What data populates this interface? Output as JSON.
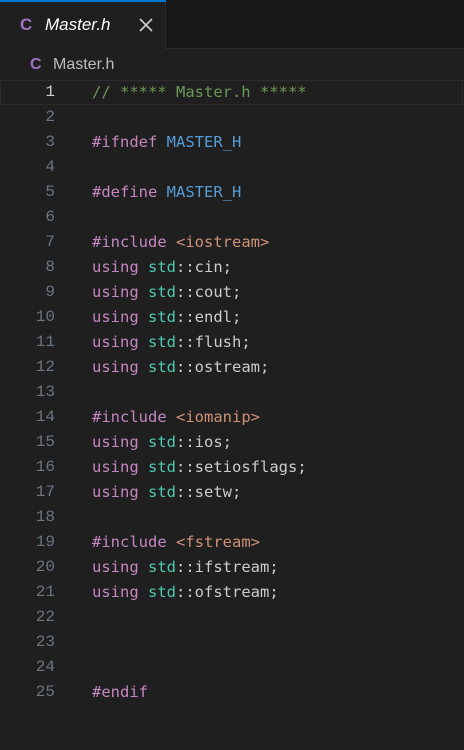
{
  "tab": {
    "lang_icon": "C",
    "title": "Master.h",
    "close": "×"
  },
  "breadcrumb": {
    "lang_icon": "C",
    "file": "Master.h"
  },
  "editor": {
    "current_line": 1,
    "lines": [
      {
        "n": "1",
        "tokens": [
          {
            "t": "// ***** Master.h *****",
            "c": "comment"
          }
        ]
      },
      {
        "n": "2",
        "tokens": []
      },
      {
        "n": "3",
        "tokens": [
          {
            "t": "#ifndef",
            "c": "kw"
          },
          {
            "t": " ",
            "c": "plain"
          },
          {
            "t": "MASTER_H",
            "c": "macro"
          }
        ]
      },
      {
        "n": "4",
        "tokens": []
      },
      {
        "n": "5",
        "tokens": [
          {
            "t": "#define",
            "c": "kw"
          },
          {
            "t": " ",
            "c": "plain"
          },
          {
            "t": "MASTER_H",
            "c": "macro"
          }
        ]
      },
      {
        "n": "6",
        "tokens": []
      },
      {
        "n": "7",
        "tokens": [
          {
            "t": "#include",
            "c": "kw"
          },
          {
            "t": " ",
            "c": "plain"
          },
          {
            "t": "<iostream>",
            "c": "str"
          }
        ]
      },
      {
        "n": "8",
        "tokens": [
          {
            "t": "using",
            "c": "kw"
          },
          {
            "t": " ",
            "c": "plain"
          },
          {
            "t": "std",
            "c": "ns"
          },
          {
            "t": "::cin;",
            "c": "plain"
          }
        ]
      },
      {
        "n": "9",
        "tokens": [
          {
            "t": "using",
            "c": "kw"
          },
          {
            "t": " ",
            "c": "plain"
          },
          {
            "t": "std",
            "c": "ns"
          },
          {
            "t": "::cout;",
            "c": "plain"
          }
        ]
      },
      {
        "n": "10",
        "tokens": [
          {
            "t": "using",
            "c": "kw"
          },
          {
            "t": " ",
            "c": "plain"
          },
          {
            "t": "std",
            "c": "ns"
          },
          {
            "t": "::endl;",
            "c": "plain"
          }
        ]
      },
      {
        "n": "11",
        "tokens": [
          {
            "t": "using",
            "c": "kw"
          },
          {
            "t": " ",
            "c": "plain"
          },
          {
            "t": "std",
            "c": "ns"
          },
          {
            "t": "::flush;",
            "c": "plain"
          }
        ]
      },
      {
        "n": "12",
        "tokens": [
          {
            "t": "using",
            "c": "kw"
          },
          {
            "t": " ",
            "c": "plain"
          },
          {
            "t": "std",
            "c": "ns"
          },
          {
            "t": "::ostream;",
            "c": "plain"
          }
        ]
      },
      {
        "n": "13",
        "tokens": []
      },
      {
        "n": "14",
        "tokens": [
          {
            "t": "#include",
            "c": "kw"
          },
          {
            "t": " ",
            "c": "plain"
          },
          {
            "t": "<iomanip>",
            "c": "str"
          }
        ]
      },
      {
        "n": "15",
        "tokens": [
          {
            "t": "using",
            "c": "kw"
          },
          {
            "t": " ",
            "c": "plain"
          },
          {
            "t": "std",
            "c": "ns"
          },
          {
            "t": "::ios;",
            "c": "plain"
          }
        ]
      },
      {
        "n": "16",
        "tokens": [
          {
            "t": "using",
            "c": "kw"
          },
          {
            "t": " ",
            "c": "plain"
          },
          {
            "t": "std",
            "c": "ns"
          },
          {
            "t": "::setiosflags;",
            "c": "plain"
          }
        ]
      },
      {
        "n": "17",
        "tokens": [
          {
            "t": "using",
            "c": "kw"
          },
          {
            "t": " ",
            "c": "plain"
          },
          {
            "t": "std",
            "c": "ns"
          },
          {
            "t": "::setw;",
            "c": "plain"
          }
        ]
      },
      {
        "n": "18",
        "tokens": []
      },
      {
        "n": "19",
        "tokens": [
          {
            "t": "#include",
            "c": "kw"
          },
          {
            "t": " ",
            "c": "plain"
          },
          {
            "t": "<fstream>",
            "c": "str"
          }
        ]
      },
      {
        "n": "20",
        "tokens": [
          {
            "t": "using",
            "c": "kw"
          },
          {
            "t": " ",
            "c": "plain"
          },
          {
            "t": "std",
            "c": "ns"
          },
          {
            "t": "::ifstream;",
            "c": "plain"
          }
        ]
      },
      {
        "n": "21",
        "tokens": [
          {
            "t": "using",
            "c": "kw"
          },
          {
            "t": " ",
            "c": "plain"
          },
          {
            "t": "std",
            "c": "ns"
          },
          {
            "t": "::ofstream;",
            "c": "plain"
          }
        ]
      },
      {
        "n": "22",
        "tokens": []
      },
      {
        "n": "23",
        "tokens": []
      },
      {
        "n": "24",
        "tokens": []
      },
      {
        "n": "25",
        "tokens": [
          {
            "t": "#endif",
            "c": "kw"
          }
        ]
      }
    ]
  },
  "colors": {
    "background": "#1f1f1f",
    "tab_accent": "#0078d4",
    "c_file_icon": "#a074c4",
    "comment": "#6a9955",
    "keyword": "#c586c0",
    "macro": "#569cd6",
    "namespace": "#4ec9b0",
    "string": "#ce9178"
  }
}
